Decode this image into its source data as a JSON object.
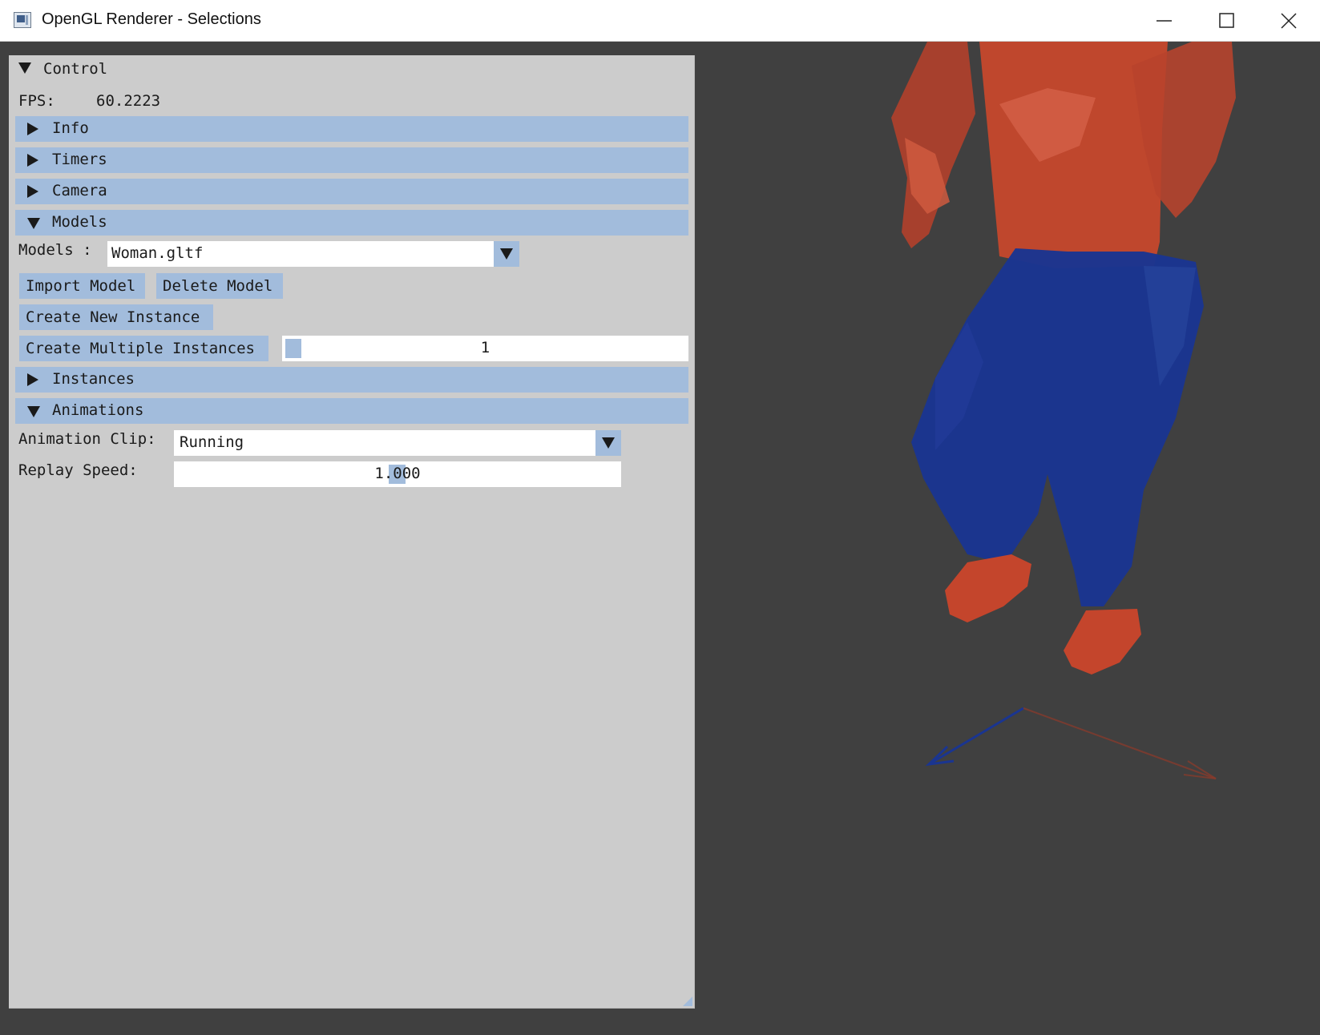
{
  "window": {
    "title": "OpenGL Renderer - Selections",
    "icon": "app-window-icon"
  },
  "control": {
    "title": "Control",
    "fps_label": "FPS:",
    "fps_value": "60.2223",
    "sections": {
      "info": "Info",
      "timers": "Timers",
      "camera": "Camera",
      "models": "Models",
      "instances": "Instances",
      "animations": "Animations"
    },
    "models": {
      "label": "Models :",
      "selected": "Woman.gltf",
      "import_label": "Import Model",
      "delete_label": "Delete Model",
      "create_instance_label": "Create New Instance",
      "create_multiple_label": "Create Multiple Instances",
      "multiple_count": "1"
    },
    "animations": {
      "clip_label": "Animation Clip:",
      "clip_selected": "Running",
      "speed_label": "Replay Speed:",
      "speed_value": "1.000"
    }
  },
  "colors": {
    "panel_bg": "#cccccc",
    "header_bg": "#a2bcdc",
    "viewport_bg": "#404040",
    "model_top": "#c2472d",
    "model_pants": "#1a3591"
  }
}
